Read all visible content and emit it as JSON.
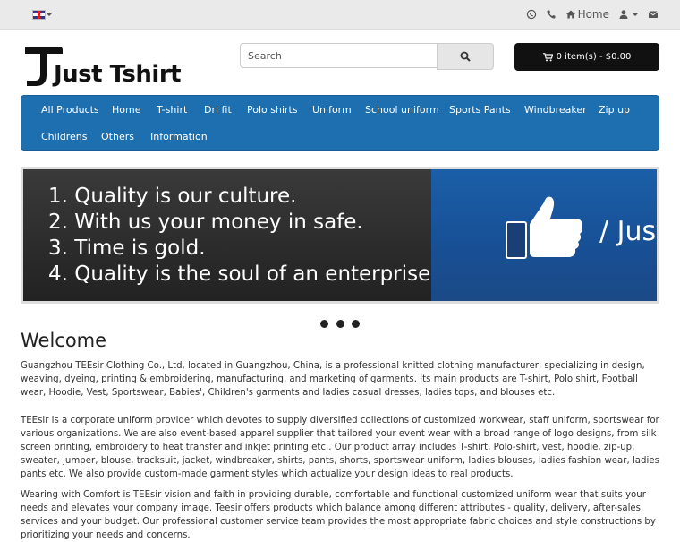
{
  "topbar": {
    "language_flag": "uk-flag-icon",
    "icons": [
      "whatsapp-icon",
      "phone-icon",
      "home-icon",
      "user-icon",
      "envelope-icon"
    ],
    "home_label": "Home"
  },
  "logo": {
    "text": "Just Tshirt"
  },
  "search": {
    "placeholder": "Search"
  },
  "cart": {
    "label": "0 item(s) - $0.00"
  },
  "nav": {
    "items": [
      "All Products",
      "Home",
      "T-shirt",
      "Dri fit",
      "Polo shirts",
      "Uniform",
      "School uniform",
      "Sports Pants",
      "Windbreaker",
      "Zip up",
      "Childrens",
      "Others",
      "Information"
    ]
  },
  "banner": {
    "lines": [
      "1. Quality is our culture.",
      "2. With us your money in safe.",
      "3. Time is gold.",
      "4. Quality is the soul of an enterprise."
    ],
    "brand": "/ Just"
  },
  "slider": {
    "dot_count": 3
  },
  "welcome": {
    "title": "Welcome",
    "paragraphs": [
      "Guangzhou TEEsir Clothing Co., Ltd, located in Guangzhou, China, is a professional knitted clothing manufacturer, specializing in design, weaving, dyeing, printing & embroidering, manufacturing, and marketing of garments. Its main products are T-shirt, Polo shirt, Football wear, Hoodie, Vest, Sportswear, Babies', Children's garments and ladies casual dresses, ladies tops, and blouses etc.",
      "TEEsir is a corporate uniform provider which devotes to supply diversified collections of customized workwear, staff uniform, sportswear for various organizations. We are also event-based apparel supplier that tailored your event wear with a broad range of logo designs, from silk screen printing, embroidery to heat transfer and inkjet printing etc.. Our product array includes T-shirt, Polo-shirt, vest, hoodie, zip-up, sweater, jumper, blouse, tracksuit, jacket, windbreaker, shirts, pants, shorts, sportswear uniform, ladies blouses, ladies fashion wear, ladies pants etc. We also provide custom-made garment styles which actualize your design ideas to real products.",
      "Wearing with Comfort is TEEsir vision and faith in providing durable, comfortable and functional customized uniform wear that suits your needs and elevates your company image. Teesir offers products which balance among different attributes - quality, delivery, after-sales services and your budget. Our professional customer service team provides the most appropriate fabric choices and style constructions by prioritizing your needs and concerns."
    ]
  }
}
